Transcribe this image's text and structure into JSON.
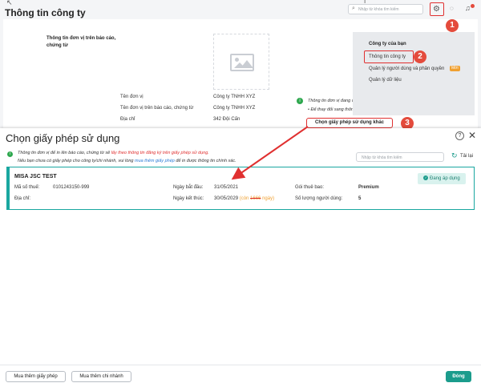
{
  "header": {
    "title": "Thông tin công ty",
    "search_placeholder": "Nhập từ khóa tìm kiếm"
  },
  "background": {
    "section_title": "Thông tin đơn vị trên báo cáo, chứng từ",
    "fields": [
      {
        "label": "Tên đơn vị",
        "value": "Công ty TNHH XYZ"
      },
      {
        "label": "Tên đơn vị trên báo cáo, chứng từ",
        "value": "Công ty TNHH XYZ"
      },
      {
        "label": "Địa chỉ",
        "value": "342 Đội Cấn"
      }
    ],
    "note1": "Thông tin đơn vị đang được lấy trên giấy phép sử dụng.",
    "note2": "Để thay đổi sang thông tin đơn vị khác, vui lòng thực hiện:",
    "choose_button": "Chọn giấy phép sử dụng khác"
  },
  "settings_menu": {
    "items": [
      "Công ty của bạn",
      "Thông tin công ty",
      "Quản lý người dùng và phân quyền",
      "Quản lý dữ liệu"
    ],
    "new_badge": "Mới"
  },
  "callouts": [
    "1",
    "2",
    "3"
  ],
  "dialog": {
    "title": "Chọn giấy phép sử dụng",
    "info_line1_prefix": "Thông tin đơn vị để in lên báo cáo, chứng từ sẽ ",
    "info_line1_highlight": "lấy theo thông tin đăng ký trên giấy phép sử dụng.",
    "info_line2_prefix": "Nếu bạn chưa có giấy phép cho công ty/chi nhánh, vui lòng ",
    "info_line2_link": "mua thêm giấy phép",
    "info_line2_suffix": " để in được thông tin chính xác.",
    "search_placeholder": "Nhập từ khóa tìm kiếm",
    "reload": "Tải lại",
    "license": {
      "name": "MISA JSC TEST",
      "tax_label": "Mã số thuế:",
      "tax_value": "0101243150-999",
      "address_label": "Địa chỉ:",
      "start_label": "Ngày bắt đầu:",
      "start_value": "31/05/2021",
      "end_label": "Ngày kết thúc:",
      "end_value": "30/05/2029",
      "remaining_prefix": "(còn ",
      "remaining_days": "1666",
      "remaining_suffix": " ngày)",
      "package_label": "Gói thuê bao:",
      "package_value": "Premium",
      "users_label": "Số lượng người dùng:",
      "users_value": "5",
      "status": "Đang áp dụng"
    },
    "buy_license": "Mua thêm giấy phép",
    "buy_branch": "Mua thêm chi nhánh",
    "close_button": "Đóng"
  },
  "colors": {
    "accent": "#1b9c8c",
    "callout": "#e44b3c",
    "highlight_text": "#e03030",
    "link": "#2a7bd6",
    "warning": "#f0a030"
  }
}
